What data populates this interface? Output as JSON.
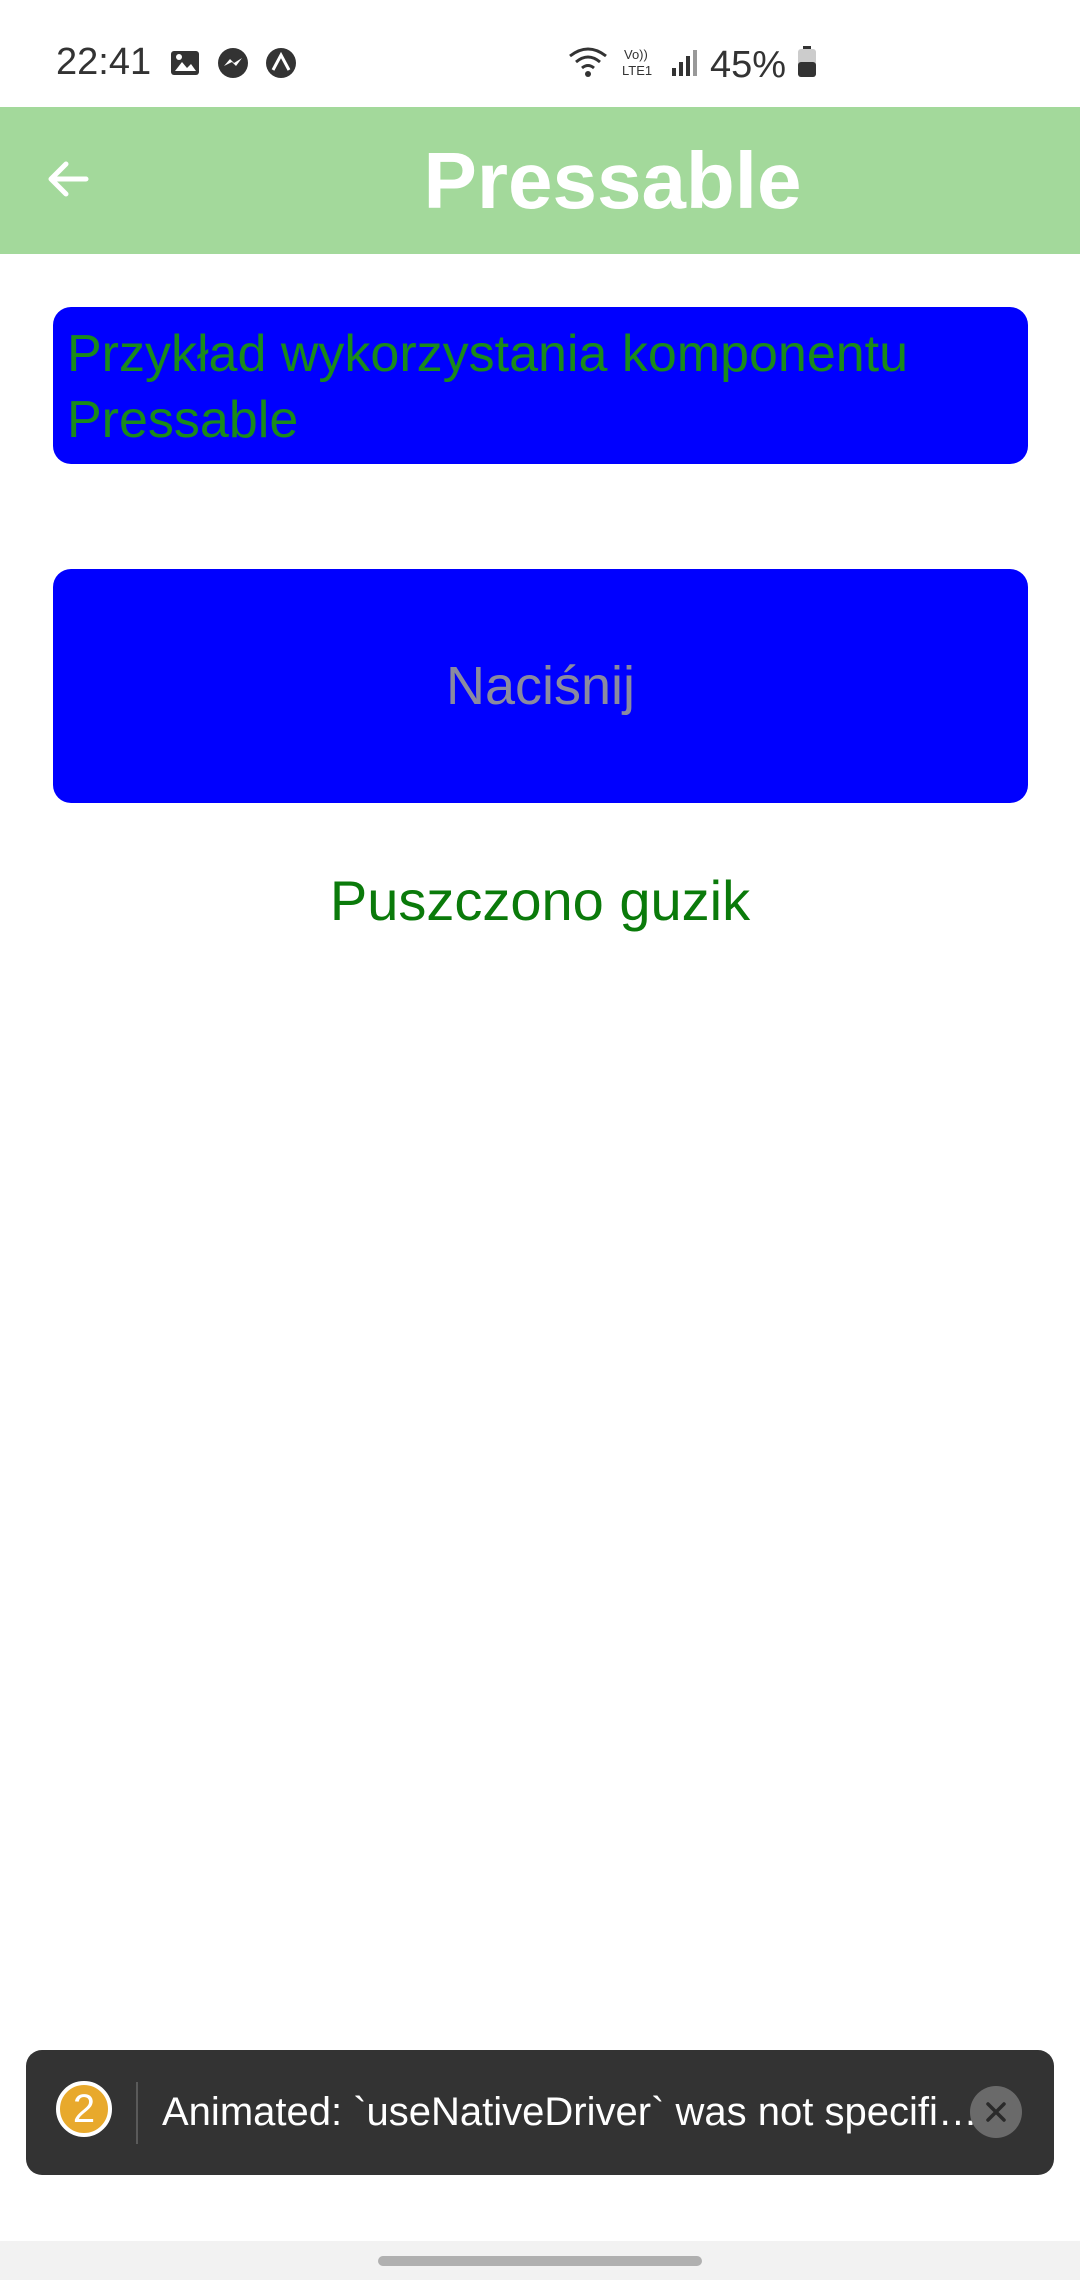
{
  "status_bar": {
    "time": "22:41",
    "battery_percent": "45%",
    "icons": [
      "gallery-icon",
      "messenger-icon",
      "expo-icon",
      "wifi-icon",
      "volte-icon",
      "signal-icon",
      "battery-icon"
    ],
    "network_label": "Vo)) LTE1"
  },
  "header": {
    "title": "Pressable",
    "background_color": "#a3d99b"
  },
  "content": {
    "example_text": "Przykład wykorzystania komponentu Pressable",
    "button_label": "Naciśnij",
    "status_message": "Puszczono guzik",
    "accent_blue": "#0000ff",
    "text_green": "#0a7a0a"
  },
  "warning_toast": {
    "count": "2",
    "message": "Animated: `useNativeDriver` was not specified. This is a required option and must be explicitly set to `true` or `false`"
  }
}
